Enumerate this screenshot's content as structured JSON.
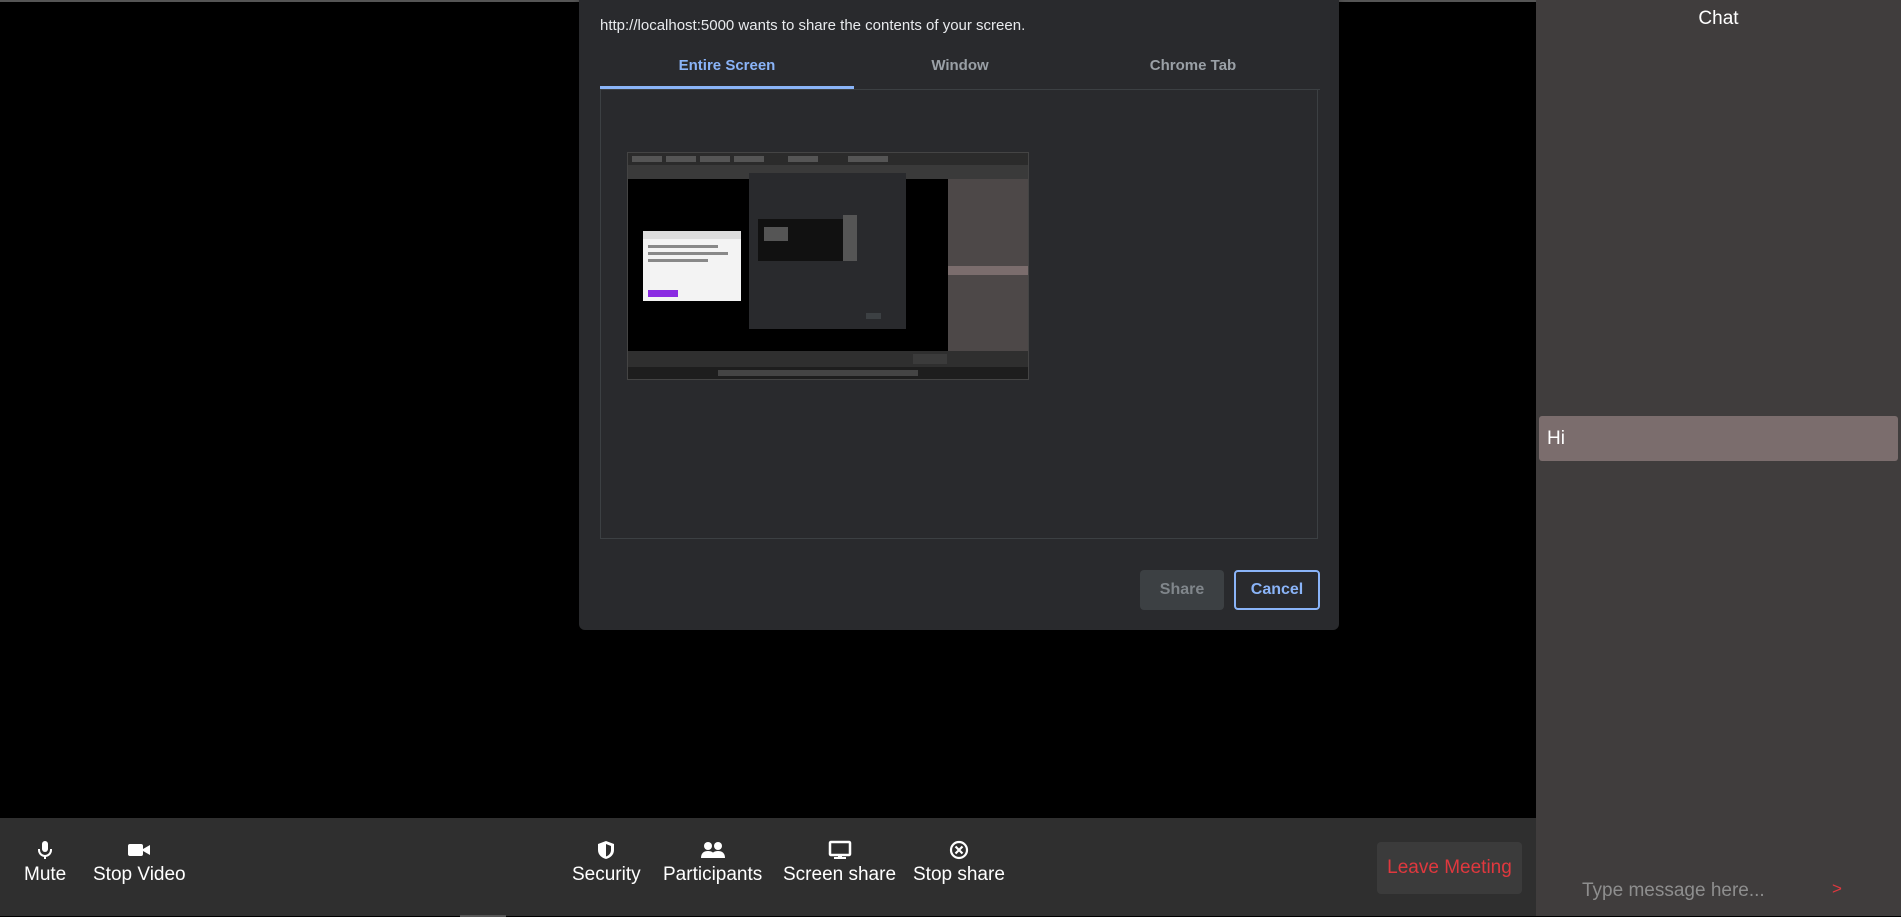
{
  "dialog": {
    "message": "http://localhost:5000 wants to share the contents of your screen.",
    "tabs": [
      {
        "label": "Entire Screen",
        "active": true
      },
      {
        "label": "Window",
        "active": false
      },
      {
        "label": "Chrome Tab",
        "active": false
      }
    ],
    "share_label": "Share",
    "cancel_label": "Cancel"
  },
  "toolbar": {
    "mute_label": "Mute",
    "stop_video_label": "Stop Video",
    "security_label": "Security",
    "participants_label": "Participants",
    "screen_share_label": "Screen share",
    "stop_share_label": "Stop share",
    "leave_label": "Leave Meeting"
  },
  "chat": {
    "title": "Chat",
    "messages": [
      {
        "text": "Hi"
      }
    ],
    "input_placeholder": "Type message here...",
    "send_label": ">"
  },
  "icons": {
    "mute": "microphone-icon",
    "stop_video": "video-camera-icon",
    "security": "shield-icon",
    "participants": "people-icon",
    "screen_share": "monitor-icon",
    "stop_share": "close-circle-icon"
  },
  "colors": {
    "accent_blue": "#8ab4f8",
    "leave_red": "#e0383e",
    "chat_bg": "#403d3d",
    "chat_msg_bg": "#7b6d6d",
    "toolbar_bg": "#2f2f2f",
    "dialog_bg": "#292a2d"
  }
}
